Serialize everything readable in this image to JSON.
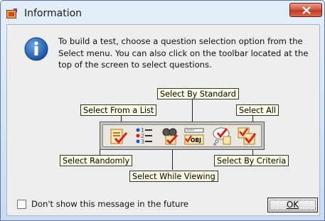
{
  "window": {
    "title": "Information",
    "close_label": "Close"
  },
  "message": "To build a test, choose a question selection option from the Select menu.  You can also click on the toolbar located at the top of the screen to select questions.",
  "diagram": {
    "labels": {
      "select_by_standard": "Select By Standard",
      "select_from_list": "Select From a List",
      "select_all": "Select All",
      "select_randomly": "Select Randomly",
      "select_while_viewing": "Select While Viewing",
      "select_by_criteria": "Select By Criteria"
    },
    "toolbar_icons": [
      "select-from-list-icon",
      "select-randomly-icon",
      "select-while-viewing-icon",
      "select-by-standard-icon",
      "select-by-criteria-icon",
      "select-all-icon"
    ]
  },
  "footer": {
    "checkbox_label": "Don't show this message in the future",
    "checkbox_checked": false,
    "ok_label": "OK"
  },
  "colors": {
    "title_bar": "#c9dcf2",
    "close_button": "#c9442c",
    "callout_bg": "#ffffe8",
    "info_icon": "#1e5fb0"
  }
}
